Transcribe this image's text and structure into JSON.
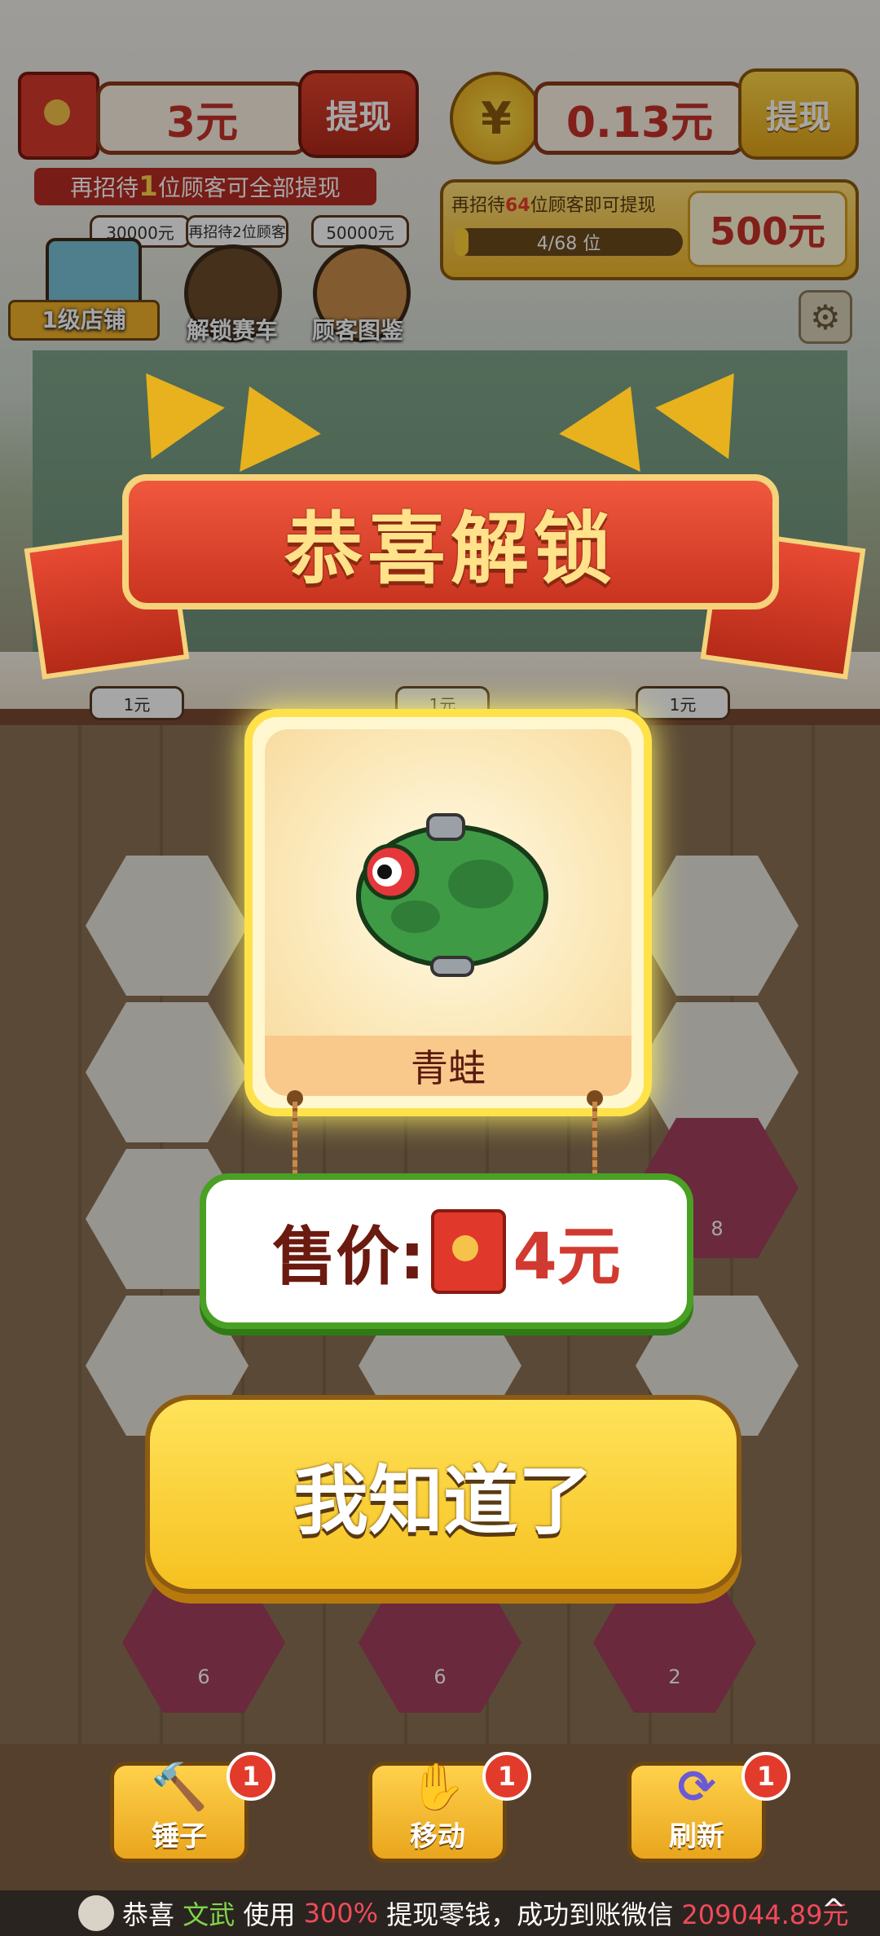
{
  "top_left": {
    "amount": "3元",
    "withdraw_label": "提现",
    "hint_prefix": "再招待",
    "hint_number": "1",
    "hint_suffix": "位顾客可全部提现"
  },
  "top_right": {
    "amount": "0.13元",
    "withdraw_label": "提现",
    "task_prefix": "再招待",
    "task_number": "64",
    "task_suffix": "位顾客即可提现",
    "progress_text": "4/68 位",
    "progress_fraction": 0.06,
    "reward": "500元"
  },
  "shop_icons": [
    {
      "price": "30000元",
      "label": "1级店铺"
    },
    {
      "price": "再招待2位顾客",
      "label": "解锁赛车"
    },
    {
      "price": "50000元",
      "label": "顾客图鉴"
    }
  ],
  "counter_prices": [
    "1元",
    "1元",
    "1元"
  ],
  "banner": {
    "title": "恭喜解锁"
  },
  "card": {
    "item_name": "青蛙",
    "icon": "frog-icon"
  },
  "price": {
    "label": "售价:",
    "value": "4元"
  },
  "confirm_button": "我知道了",
  "hex_counts": [
    "8",
    "6",
    "6",
    "2"
  ],
  "toolbar": [
    {
      "label": "锤子",
      "badge": "1",
      "icon": "hammer-icon"
    },
    {
      "label": "移动",
      "badge": "1",
      "icon": "hand-icon"
    },
    {
      "label": "刷新",
      "badge": "1",
      "icon": "refresh-icon"
    }
  ],
  "ticker": {
    "prefix": "恭喜",
    "user": "文武",
    "mid": "使用",
    "percent": "300%",
    "action": "提现零钱，成功到账微信",
    "amount": "209044.89元",
    "arrow": "^"
  },
  "colors": {
    "accent_red": "#c7322a",
    "accent_gold": "#ffd14c",
    "green": "#4aa024"
  }
}
